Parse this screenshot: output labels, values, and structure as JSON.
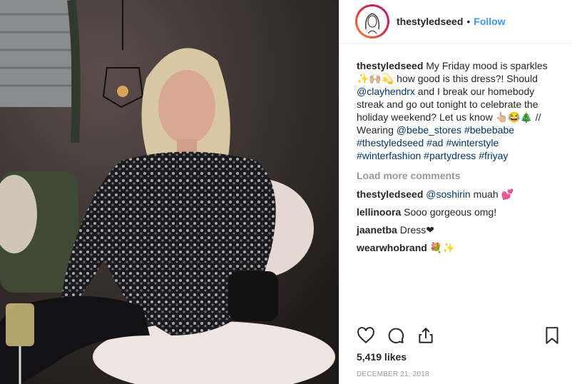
{
  "post": {
    "username": "thestyledseed",
    "follow_label": "Follow",
    "separator": "•"
  },
  "caption": {
    "username": "thestyledseed",
    "text_1": " My Friday mood is sparkles ✨🙌🏼💫 how good is this dress?! Should ",
    "mention_1": "@clayhendrx",
    "text_2": " and I break our homebody streak and go out tonight to celebrate the holiday weekend? Let us know 👆🏼😂🎄 // Wearing ",
    "mention_2": "@bebe_stores",
    "text_3": " ",
    "hashtags": "#bebebabe #thestyledseed #ad #winterstyle #winterfashion #partydress #friyay"
  },
  "load_more": "Load more comments",
  "comments": [
    {
      "username": "thestyledseed",
      "mention": "@soshirin",
      "text": " muah 💕"
    },
    {
      "username": "lellinoora",
      "text": " Sooo gorgeous omg!"
    },
    {
      "username": "jaanetba",
      "text": " Dress❤"
    },
    {
      "username": "wearwhobrand",
      "text": " 💐✨"
    }
  ],
  "likes": "5,419 likes",
  "date": "DECEMBER 21, 2018",
  "icons": [
    "heart-icon",
    "comment-icon",
    "share-icon",
    "bookmark-icon"
  ]
}
